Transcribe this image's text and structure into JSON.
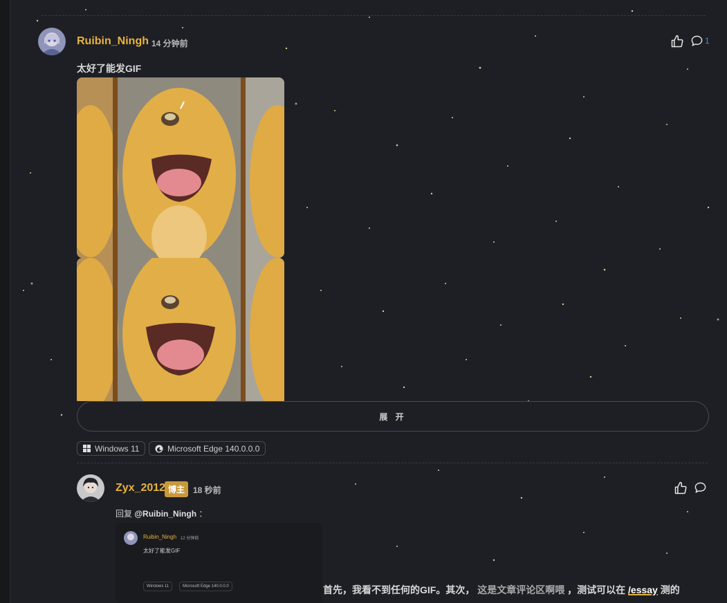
{
  "comments": [
    {
      "username": "Ruibin_Ningh",
      "time": "14 分钟前",
      "text": "太好了能发GIF",
      "reply_count": "1",
      "expand_label": "展 开",
      "os_tag": "Windows 11",
      "browser_tag": "Microsoft Edge 140.0.0.0"
    },
    {
      "username": "Zyx_2012",
      "badge": "博主",
      "time": "18 秒前",
      "reply_label": "回复",
      "reply_to": "@Ruibin_Ningh",
      "reply_colon": "：",
      "quote": {
        "username": "Ruibin_Ningh",
        "time": "12 分钟前",
        "text": "太好了能发GIF",
        "os_tag": "Windows 11",
        "browser_tag": "Microsoft Edge 140.0.0.0"
      },
      "body_part1": "首先，我看不到任何的GIF。其次，",
      "body_part2": "这是文章评论区啊喂",
      "body_part3": "，测试可以在",
      "body_link": "/essay",
      "body_part4": "测的"
    }
  ],
  "colors": {
    "accent": "#e8b43c",
    "badge": "#c8993a",
    "link": "#3a8ee6",
    "background": "#1e1f24"
  },
  "icons": [
    "thumbs-up-icon",
    "comment-icon",
    "windows-icon",
    "edge-icon"
  ]
}
